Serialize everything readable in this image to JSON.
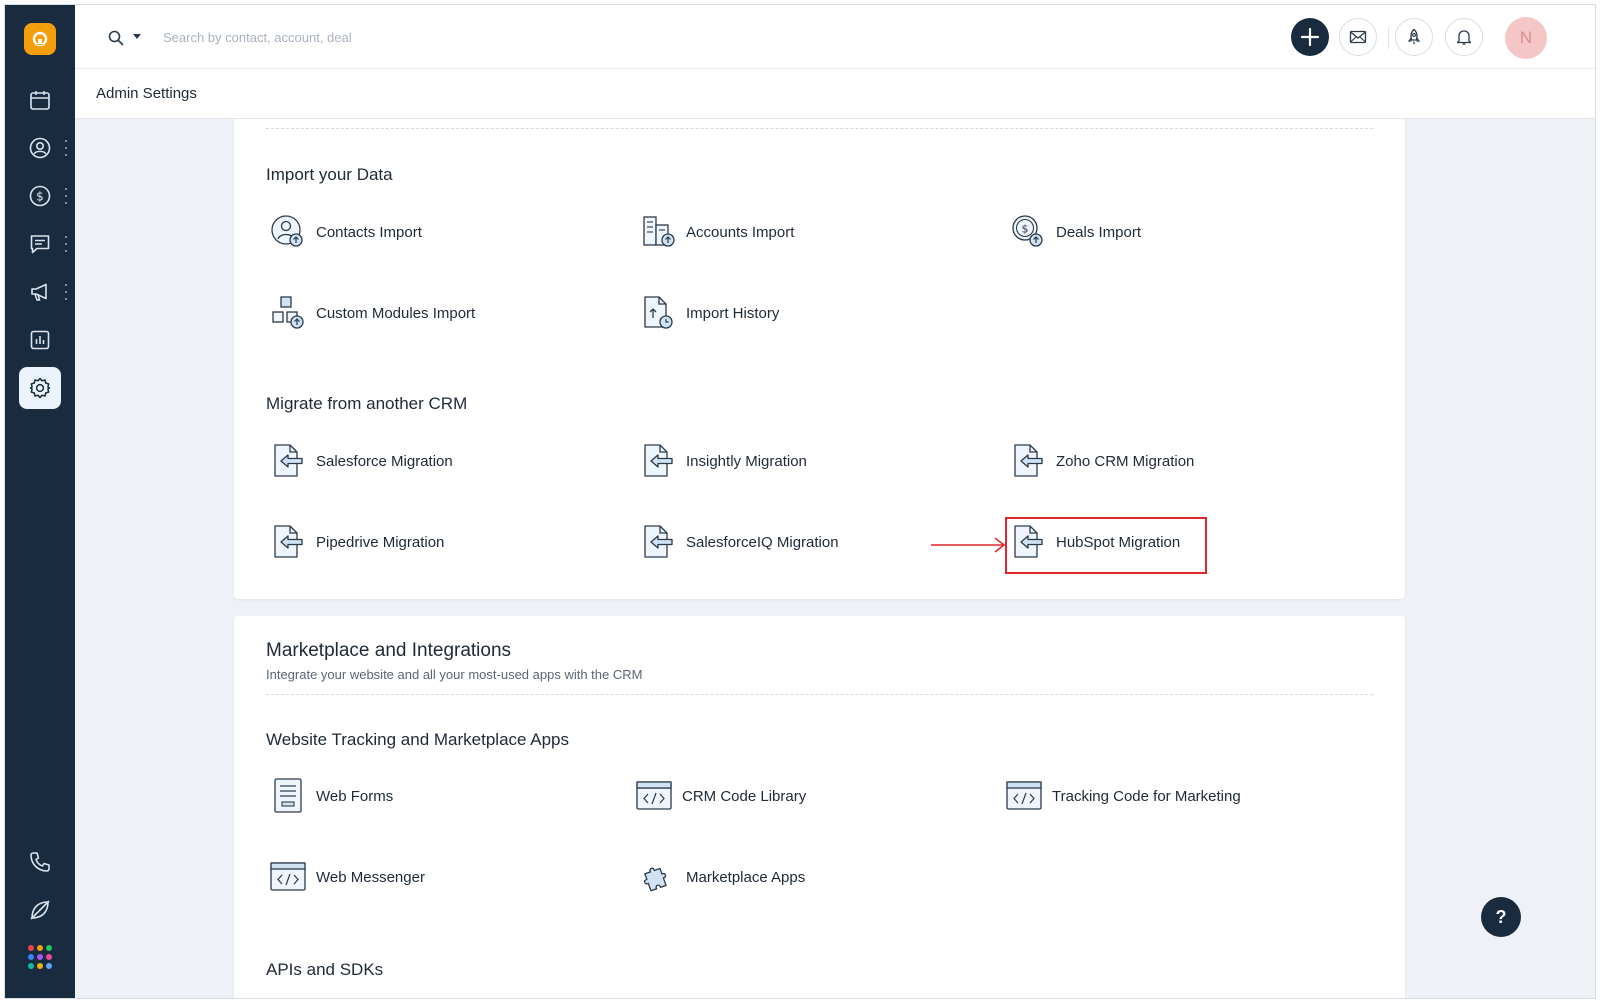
{
  "topbar": {
    "search_placeholder": "Search by contact, account, deal",
    "avatar_initial": "N"
  },
  "header": {
    "title": "Admin Settings"
  },
  "import_section": {
    "title": "Import your Data",
    "items": [
      {
        "label": "Contacts Import",
        "icon": "contacts-import-icon"
      },
      {
        "label": "Accounts Import",
        "icon": "accounts-import-icon"
      },
      {
        "label": "Deals Import",
        "icon": "deals-import-icon"
      },
      {
        "label": "Custom Modules Import",
        "icon": "custom-modules-icon"
      },
      {
        "label": "Import History",
        "icon": "import-history-icon"
      }
    ]
  },
  "migrate_section": {
    "title": "Migrate from another CRM",
    "items": [
      {
        "label": "Salesforce Migration"
      },
      {
        "label": "Insightly Migration"
      },
      {
        "label": "Zoho CRM Migration"
      },
      {
        "label": "Pipedrive Migration"
      },
      {
        "label": "SalesforceIQ Migration"
      },
      {
        "label": "HubSpot Migration"
      }
    ]
  },
  "marketplace_card": {
    "title": "Marketplace and Integrations",
    "subtitle": "Integrate your website and all your most-used apps with the CRM",
    "tracking_section": {
      "title": "Website Tracking and Marketplace Apps",
      "items": [
        {
          "label": "Web Forms",
          "icon": "web-forms-icon"
        },
        {
          "label": "CRM Code Library",
          "icon": "code-library-icon"
        },
        {
          "label": "Tracking Code for Marketing",
          "icon": "tracking-code-icon"
        },
        {
          "label": "Web Messenger",
          "icon": "web-messenger-icon"
        },
        {
          "label": "Marketplace Apps",
          "icon": "puzzle-icon"
        }
      ]
    },
    "apis_section": {
      "title": "APIs and SDKs"
    }
  },
  "help": {
    "label": "?"
  },
  "colors": {
    "sidebar": "#182b3f",
    "accent": "#f59e0b",
    "highlight": "#e0262b",
    "icon_fill": "#cfe3f5"
  }
}
